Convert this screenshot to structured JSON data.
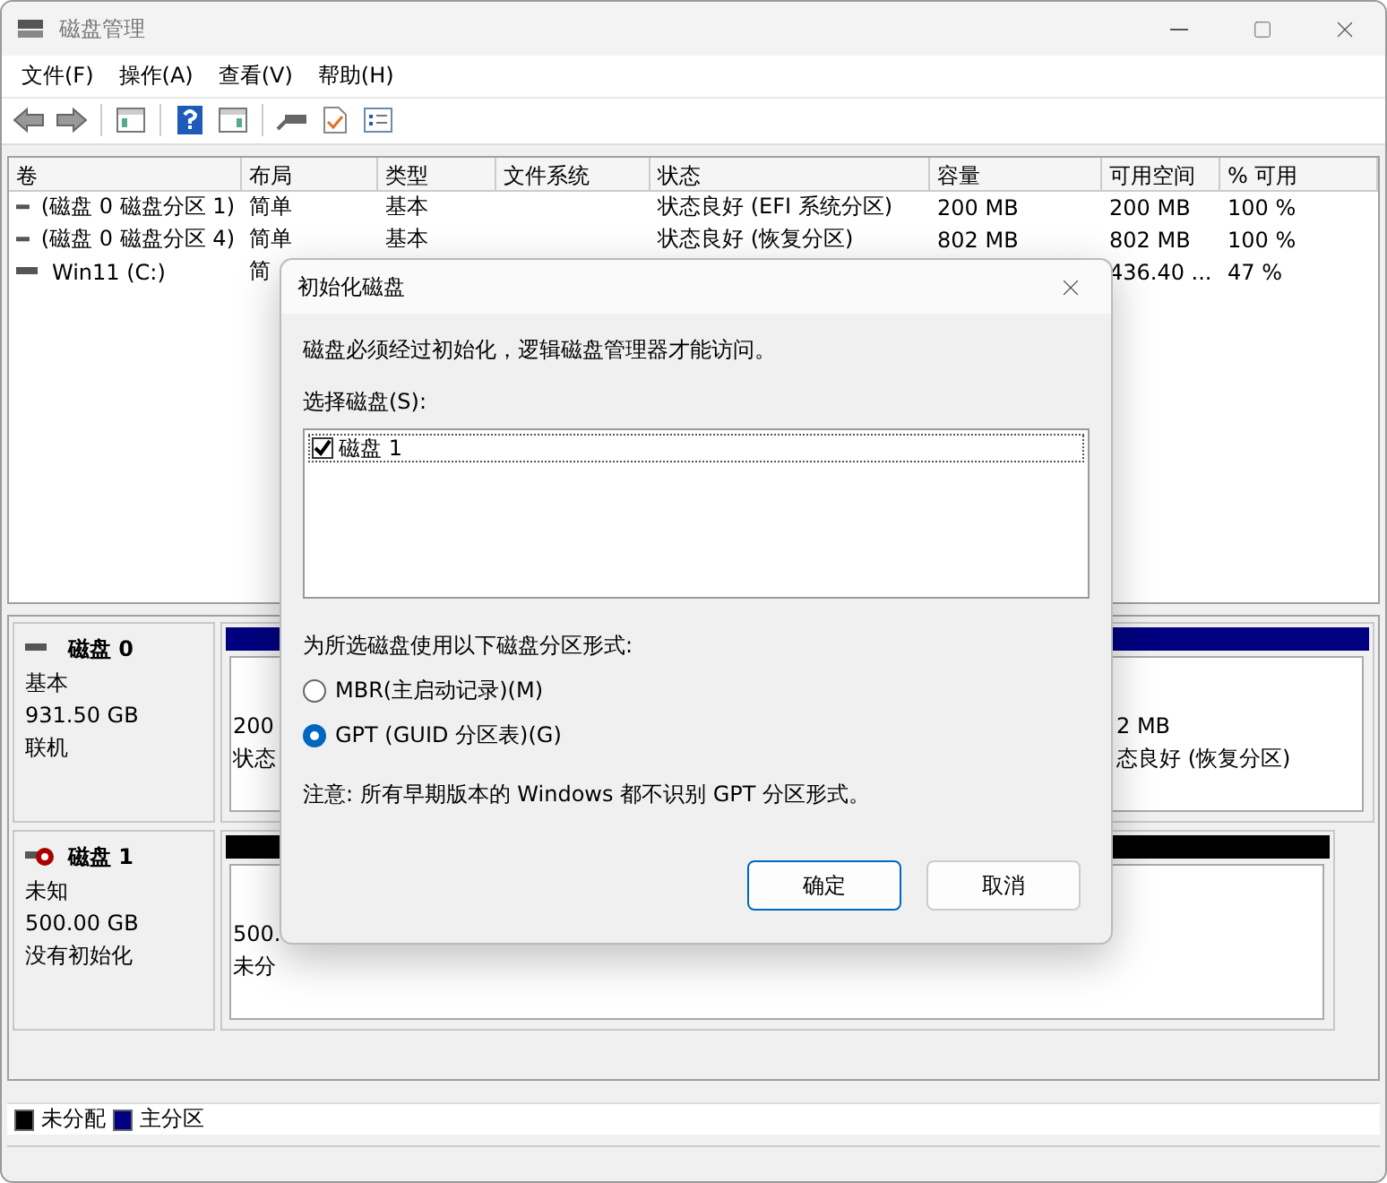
{
  "window": {
    "title": "磁盘管理"
  },
  "menu": [
    "文件(F)",
    "操作(A)",
    "查看(V)",
    "帮助(H)"
  ],
  "volume_list": {
    "columns": [
      "卷",
      "布局",
      "类型",
      "文件系统",
      "状态",
      "容量",
      "可用空间",
      "% 可用"
    ],
    "rows": [
      {
        "cells": [
          "(磁盘 0 磁盘分区 1)",
          "简单",
          "基本",
          null,
          "状态良好 (EFI 系统分区)",
          "200 MB",
          "200 MB",
          "100 %"
        ]
      },
      {
        "cells": [
          "(磁盘 0 磁盘分区 4)",
          "简单",
          "基本",
          null,
          "状态良好 (恢复分区)",
          "802 MB",
          "802 MB",
          "100 %"
        ]
      },
      {
        "cells": [
          "Win11 (C:)",
          "简",
          null,
          null,
          null,
          null,
          "436.40 ...",
          "47 %"
        ]
      }
    ]
  },
  "disks": [
    {
      "name": "磁盘 0",
      "kind": "online",
      "type": "基本",
      "size": "931.50 GB",
      "status": "联机",
      "partitions": [
        {
          "lines": [
            "200",
            "状态"
          ],
          "color": "#000080"
        },
        {
          "lines": [
            "2 MB",
            "态良好 (恢复分区)"
          ],
          "color": "#000080"
        }
      ]
    },
    {
      "name": "磁盘 1",
      "kind": "uninitialized",
      "type": "未知",
      "size": "500.00 GB",
      "status": "没有初始化",
      "partitions": [
        {
          "lines": [
            "500.",
            "未分"
          ],
          "color": "#000000"
        }
      ]
    }
  ],
  "legend": [
    {
      "label": "未分配",
      "color": "#000000"
    },
    {
      "label": "主分区",
      "color": "#000080"
    }
  ],
  "dialog": {
    "title": "初始化磁盘",
    "message": "磁盘必须经过初始化，逻辑磁盘管理器才能访问。",
    "select_label": "选择磁盘(S):",
    "disks": [
      {
        "label": "磁盘 1",
        "checked": true
      }
    ],
    "style_label": "为所选磁盘使用以下磁盘分区形式:",
    "options": [
      {
        "label": "MBR(主启动记录)(M)",
        "selected": false
      },
      {
        "label": "GPT (GUID 分区表)(G)",
        "selected": true
      }
    ],
    "note": "注意: 所有早期版本的 Windows 都不识别 GPT 分区形式。",
    "buttons": [
      {
        "label": "确定",
        "default": true
      },
      {
        "label": "取消",
        "default": false
      }
    ]
  }
}
